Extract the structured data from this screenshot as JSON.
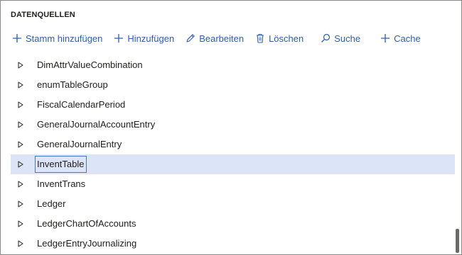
{
  "section": {
    "title": "DATENQUELLEN"
  },
  "toolbar": {
    "add_root_label": "Stamm hinzufügen",
    "add_label": "Hinzufügen",
    "edit_label": "Bearbeiten",
    "delete_label": "Löschen",
    "search_label": "Suche",
    "cache_label": "Cache",
    "accent_color": "#2b5fb3"
  },
  "tree": {
    "items": [
      {
        "label": "DimAttrValueCombination"
      },
      {
        "label": "enumTableGroup"
      },
      {
        "label": "FiscalCalendarPeriod"
      },
      {
        "label": "GeneralJournalAccountEntry"
      },
      {
        "label": "GeneralJournalEntry"
      },
      {
        "label": "InventTable",
        "selected": true
      },
      {
        "label": "InventTrans"
      },
      {
        "label": "Ledger"
      },
      {
        "label": "LedgerChartOfAccounts"
      },
      {
        "label": "LedgerEntryJournalizing"
      }
    ],
    "selected_color": "#dbe5f7"
  }
}
